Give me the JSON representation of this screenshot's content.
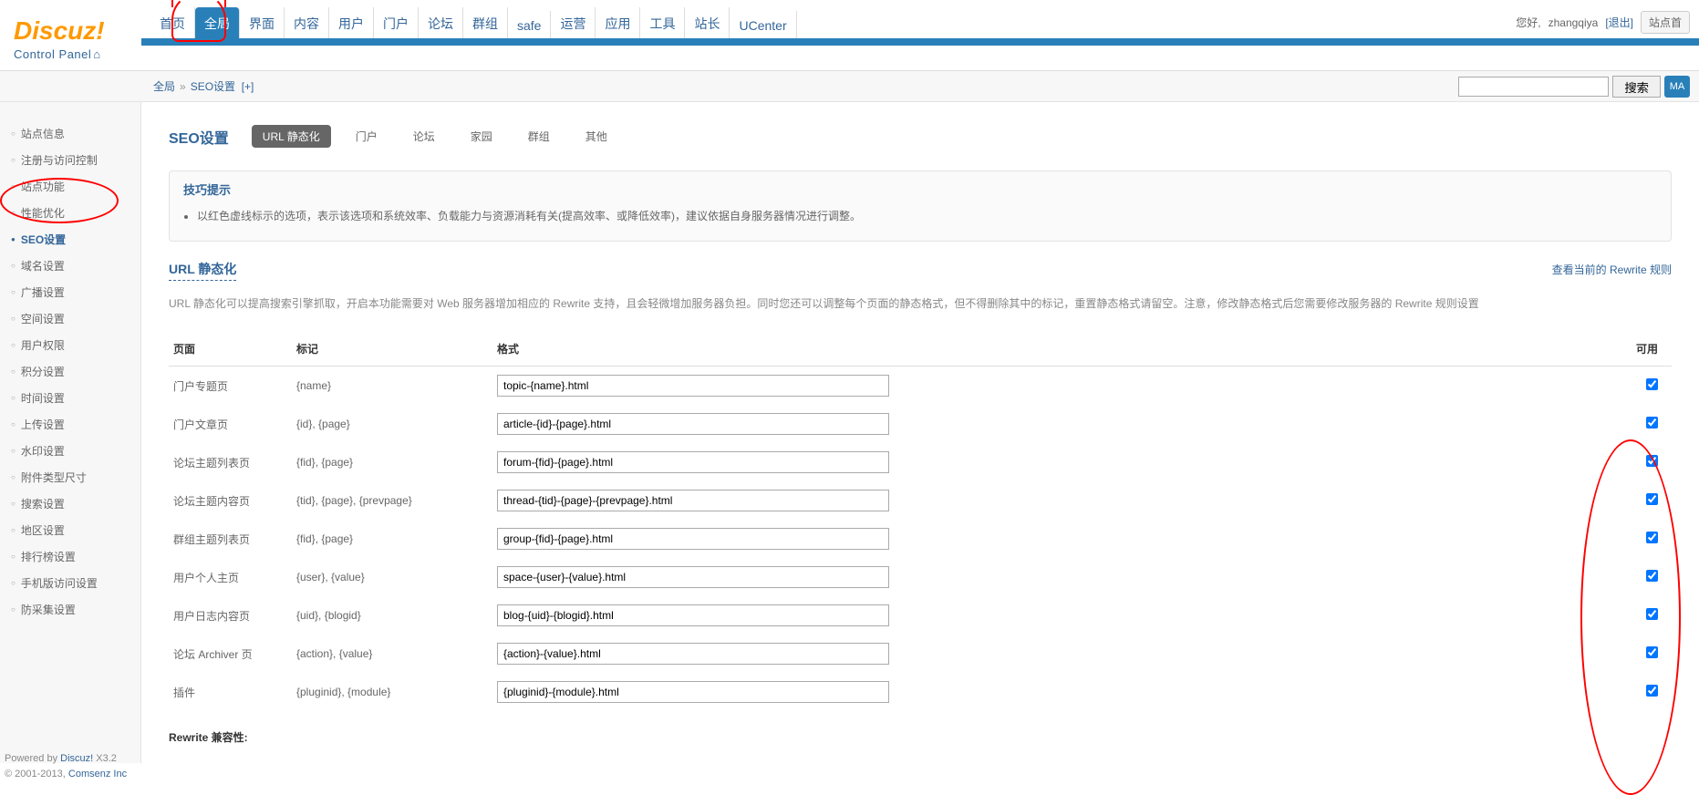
{
  "logo": {
    "main": "Discuz!",
    "sub": "Control Panel"
  },
  "user": {
    "greeting": "您好,",
    "name": "zhangqiya",
    "logout": "[退出]",
    "sitehome": "站点首"
  },
  "topnav": [
    {
      "label": "首页",
      "active": false
    },
    {
      "label": "全局",
      "active": true
    },
    {
      "label": "界面",
      "active": false
    },
    {
      "label": "内容",
      "active": false
    },
    {
      "label": "用户",
      "active": false
    },
    {
      "label": "门户",
      "active": false
    },
    {
      "label": "论坛",
      "active": false
    },
    {
      "label": "群组",
      "active": false
    },
    {
      "label": "safe",
      "active": false
    },
    {
      "label": "运营",
      "active": false
    },
    {
      "label": "应用",
      "active": false
    },
    {
      "label": "工具",
      "active": false
    },
    {
      "label": "站长",
      "active": false
    },
    {
      "label": "UCenter",
      "active": false
    }
  ],
  "breadcrumb": {
    "a": "全局",
    "sep": "»",
    "b": "SEO设置",
    "plus": "[+]"
  },
  "search": {
    "btn": "搜索",
    "pref": "MA"
  },
  "sidebar": [
    {
      "label": "站点信息",
      "active": false
    },
    {
      "label": "注册与访问控制",
      "active": false
    },
    {
      "label": "站点功能",
      "active": false
    },
    {
      "label": "性能优化",
      "active": false
    },
    {
      "label": "SEO设置",
      "active": true
    },
    {
      "label": "域名设置",
      "active": false
    },
    {
      "label": "广播设置",
      "active": false
    },
    {
      "label": "空间设置",
      "active": false
    },
    {
      "label": "用户权限",
      "active": false
    },
    {
      "label": "积分设置",
      "active": false
    },
    {
      "label": "时间设置",
      "active": false
    },
    {
      "label": "上传设置",
      "active": false
    },
    {
      "label": "水印设置",
      "active": false
    },
    {
      "label": "附件类型尺寸",
      "active": false
    },
    {
      "label": "搜索设置",
      "active": false
    },
    {
      "label": "地区设置",
      "active": false
    },
    {
      "label": "排行榜设置",
      "active": false
    },
    {
      "label": "手机版访问设置",
      "active": false
    },
    {
      "label": "防采集设置",
      "active": false
    }
  ],
  "page": {
    "title": "SEO设置",
    "tabs": [
      {
        "label": "URL 静态化",
        "active": true
      },
      {
        "label": "门户",
        "active": false
      },
      {
        "label": "论坛",
        "active": false
      },
      {
        "label": "家园",
        "active": false
      },
      {
        "label": "群组",
        "active": false
      },
      {
        "label": "其他",
        "active": false
      }
    ]
  },
  "tip": {
    "title": "技巧提示",
    "items": [
      "以红色虚线标示的选项，表示该选项和系统效率、负载能力与资源消耗有关(提高效率、或降低效率)，建议依据自身服务器情况进行调整。"
    ]
  },
  "section": {
    "title": "URL 静态化",
    "link": "查看当前的 Rewrite 规则",
    "desc": "URL 静态化可以提高搜索引擎抓取，开启本功能需要对 Web 服务器增加相应的 Rewrite 支持，且会轻微增加服务器负担。同时您还可以调整每个页面的静态格式，但不得删除其中的标记，重置静态格式请留空。注意，修改静态格式后您需要修改服务器的 Rewrite 规则设置"
  },
  "table": {
    "headers": {
      "page": "页面",
      "tag": "标记",
      "format": "格式",
      "enable": "可用"
    },
    "rows": [
      {
        "page": "门户专题页",
        "tag": "{name}",
        "format": "topic-{name}.html",
        "checked": true
      },
      {
        "page": "门户文章页",
        "tag": "{id}, {page}",
        "format": "article-{id}-{page}.html",
        "checked": true
      },
      {
        "page": "论坛主题列表页",
        "tag": "{fid}, {page}",
        "format": "forum-{fid}-{page}.html",
        "checked": true
      },
      {
        "page": "论坛主题内容页",
        "tag": "{tid}, {page}, {prevpage}",
        "format": "thread-{tid}-{page}-{prevpage}.html",
        "checked": true
      },
      {
        "page": "群组主题列表页",
        "tag": "{fid}, {page}",
        "format": "group-{fid}-{page}.html",
        "checked": true
      },
      {
        "page": "用户个人主页",
        "tag": "{user}, {value}",
        "format": "space-{user}-{value}.html",
        "checked": true
      },
      {
        "page": "用户日志内容页",
        "tag": "{uid}, {blogid}",
        "format": "blog-{uid}-{blogid}.html",
        "checked": true
      },
      {
        "page": "论坛 Archiver 页",
        "tag": "{action}, {value}",
        "format": "{action}-{value}.html",
        "checked": true
      },
      {
        "page": "插件",
        "tag": "{pluginid}, {module}",
        "format": "{pluginid}-{module}.html",
        "checked": true
      }
    ]
  },
  "footer": "Rewrite 兼容性:",
  "poweredby": {
    "l1a": "Powered by ",
    "l1b": "Discuz!",
    "l1c": " X3.2",
    "l2a": "© 2001-2013, ",
    "l2b": "Comsenz Inc"
  }
}
